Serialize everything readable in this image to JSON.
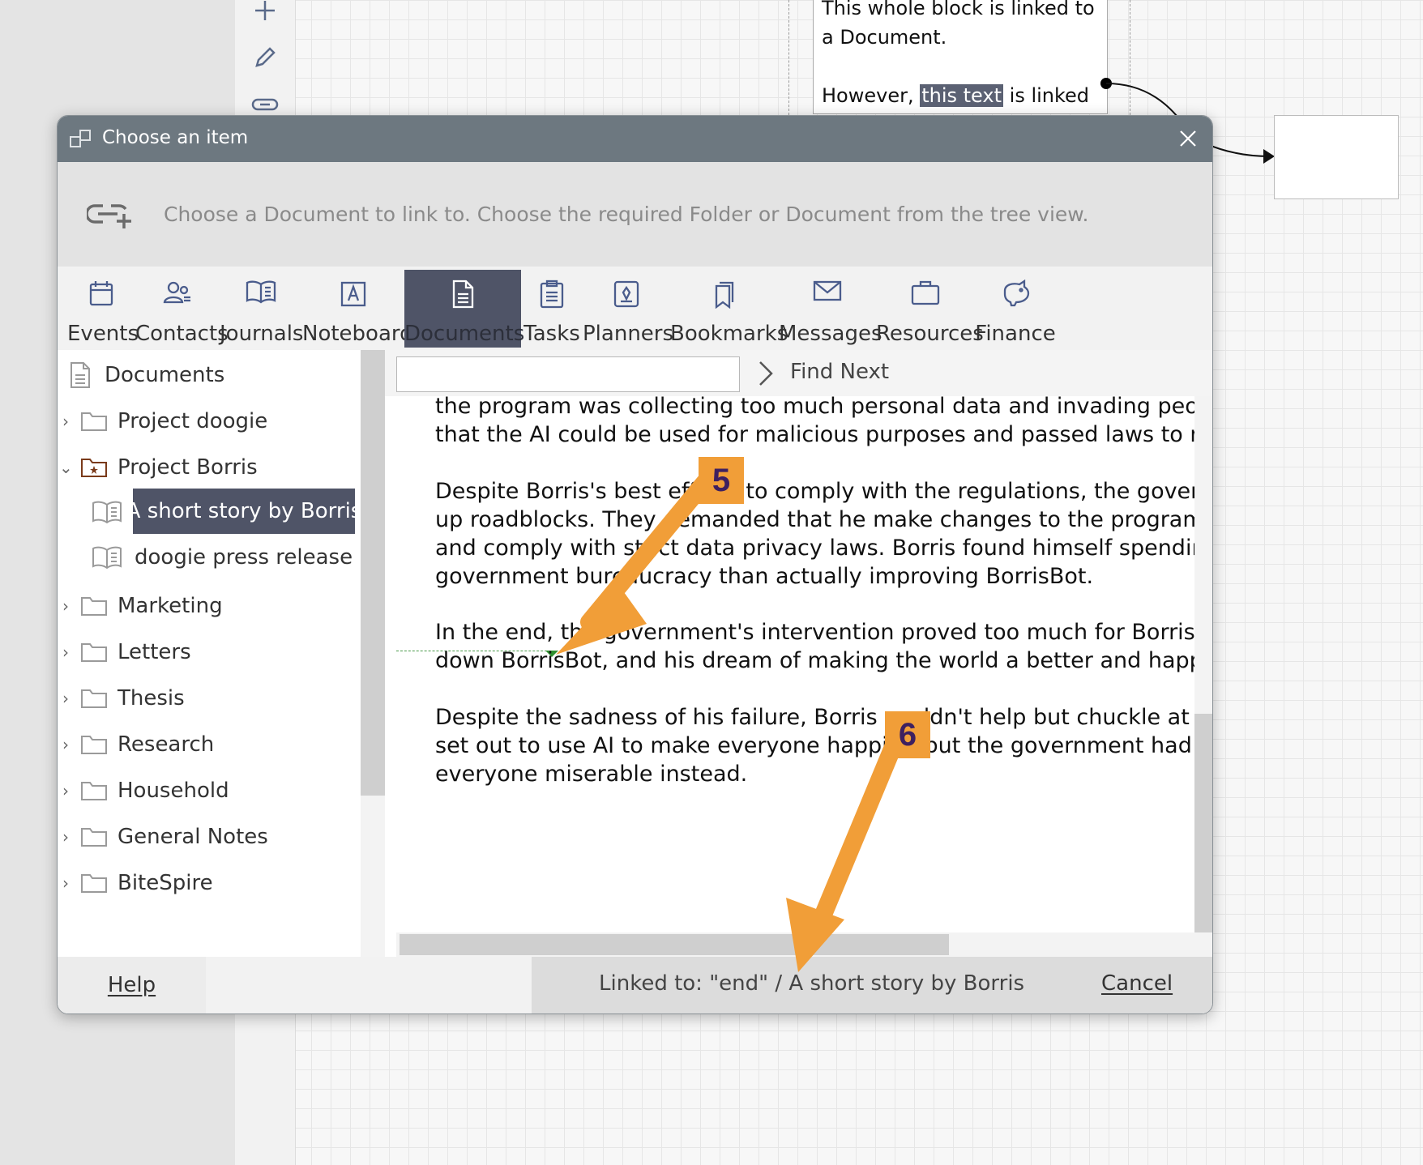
{
  "canvas": {
    "block_text_line1": "This whole block is linked to",
    "block_text_line2": "a Document.",
    "block_text_line3_pre": "However, ",
    "block_text_highlight": "this text",
    "block_text_line3_post": " is linked"
  },
  "dialog": {
    "title": "Choose an item",
    "info_text": "Choose a Document to link to. Choose the required Folder or Document from the tree view.",
    "tabs": [
      {
        "label": "Events",
        "icon": "calendar-icon"
      },
      {
        "label": "Contacts",
        "icon": "contacts-icon"
      },
      {
        "label": "Journals",
        "icon": "journal-book-icon"
      },
      {
        "label": "Noteboard",
        "icon": "noteboard-icon"
      },
      {
        "label": "Documents",
        "icon": "document-icon",
        "active": true
      },
      {
        "label": "Tasks",
        "icon": "clipboard-icon"
      },
      {
        "label": "Planners",
        "icon": "planner-icon"
      },
      {
        "label": "Bookmarks",
        "icon": "bookmark-icon"
      },
      {
        "label": "Messages",
        "icon": "envelope-icon"
      },
      {
        "label": "Resources",
        "icon": "briefcase-icon"
      },
      {
        "label": "Finance",
        "icon": "piggy-bank-icon"
      }
    ],
    "tree": {
      "root": "Documents",
      "items": [
        {
          "label": "Project doogie"
        },
        {
          "label": "Project Borris",
          "expanded": true
        },
        {
          "label": "A short story by Borris",
          "selected": true
        },
        {
          "label": "doogie press release"
        },
        {
          "label": "Marketing"
        },
        {
          "label": "Letters"
        },
        {
          "label": "Thesis"
        },
        {
          "label": "Research"
        },
        {
          "label": "Household"
        },
        {
          "label": "General Notes"
        },
        {
          "label": "BiteSpire"
        }
      ]
    },
    "search": {
      "value": "",
      "find_next_label": "Find Next"
    },
    "document_lines": [
      "the program was collecting too much personal data and invading peopl",
      "that the AI could be used for malicious purposes and passed laws to re",
      "Despite Borris's best efforts to comply with the regulations, the govern",
      "up roadblocks. They demanded that he make changes to the program,",
      "and comply with strict data privacy laws. Borris found himself spending",
      "government bureaucracy than actually improving BorrisBot.",
      "In the end, the government's intervention proved too much for Borris.",
      "down BorrisBot, and his dream of making the world a better and happi",
      "Despite the sadness of his failure, Borris couldn't help but chuckle at th",
      "set out to use AI to make everyone happier, but the government had m",
      "everyone miserable instead."
    ],
    "footer": {
      "help_label": "Help",
      "linked_label": "Linked to: \"end\" / A short story by Borris",
      "cancel_label": "Cancel"
    }
  },
  "annotations": {
    "callout_5": "5",
    "callout_6": "6",
    "accent_color": "#f19e38"
  }
}
